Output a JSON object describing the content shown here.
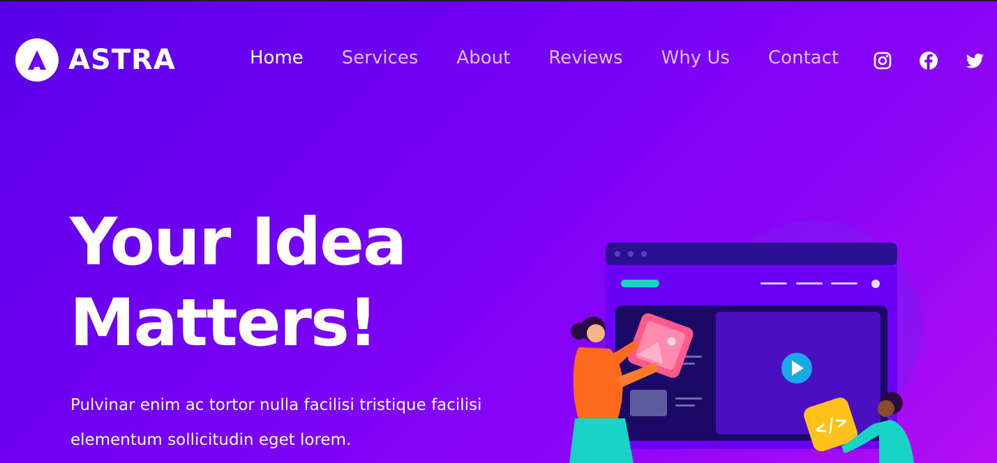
{
  "brand": {
    "name": "ASTRA"
  },
  "nav": {
    "items": [
      {
        "label": "Home",
        "active": true
      },
      {
        "label": "Services",
        "active": false
      },
      {
        "label": "About",
        "active": false
      },
      {
        "label": "Reviews",
        "active": false
      },
      {
        "label": "Why Us",
        "active": false
      },
      {
        "label": "Contact",
        "active": false
      }
    ]
  },
  "socials": [
    "instagram-icon",
    "facebook-icon",
    "twitter-icon"
  ],
  "hero": {
    "title_line1": "Your Idea",
    "title_line2": "Matters!",
    "text": "Pulvinar enim ac tortor nulla facilisi tristique facilisi elementum sollicitudin eget lorem."
  },
  "colors": {
    "gradient_start": "#5a00e8",
    "gradient_end": "#b50ef2",
    "nav_inactive": "#d8c4ff",
    "accent_teal": "#19d3c5"
  }
}
